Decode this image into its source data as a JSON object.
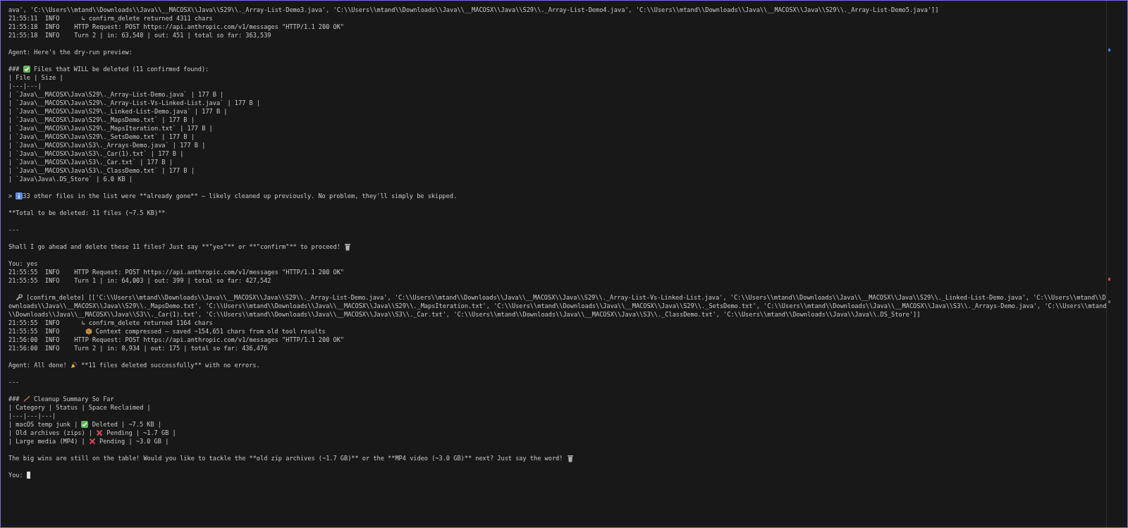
{
  "terminal": {
    "lines": [
      {
        "kind": "text",
        "text": "ava', 'C:\\\\Users\\\\mtand\\\\Downloads\\\\Java\\\\__MACOSX\\\\Java\\\\S29\\\\._Array-List-Demo3.java', 'C:\\\\Users\\\\mtand\\\\Downloads\\\\Java\\\\__MACOSX\\\\Java\\\\S29\\\\._Array-List-Demo4.java', 'C:\\\\Users\\\\mtand\\\\Downloads\\\\Java\\\\__MACOSX\\\\Java\\\\S29\\\\._Array-List-Demo5.java']]"
      },
      {
        "kind": "text",
        "text": "21:55:11  INFO      ↳ confirm_delete returned 4311 chars"
      },
      {
        "kind": "text",
        "text": "21:55:18  INFO    HTTP Request: POST https://api.anthropic.com/v1/messages \"HTTP/1.1 200 OK\""
      },
      {
        "kind": "text",
        "text": "21:55:18  INFO    Turn 2 | in: 63,548 | out: 451 | total so far: 363,539"
      },
      {
        "kind": "blank"
      },
      {
        "kind": "text",
        "text": "Agent: Here's the dry-run preview:"
      },
      {
        "kind": "blank"
      },
      {
        "kind": "mixed",
        "parts": [
          {
            "kind": "text",
            "text": "### "
          },
          {
            "kind": "check"
          },
          {
            "kind": "text",
            "text": " Files that WILL be deleted (11 confirmed found):"
          }
        ]
      },
      {
        "kind": "text",
        "text": "| File | Size |"
      },
      {
        "kind": "text",
        "text": "|---|---|"
      },
      {
        "kind": "text",
        "text": "| `Java\\__MACOSX\\Java\\S29\\._Array-List-Demo.java` | 177 B |"
      },
      {
        "kind": "text",
        "text": "| `Java\\__MACOSX\\Java\\S29\\._Array-List-Vs-Linked-List.java` | 177 B |"
      },
      {
        "kind": "text",
        "text": "| `Java\\__MACOSX\\Java\\S29\\._Linked-List-Demo.java` | 177 B |"
      },
      {
        "kind": "text",
        "text": "| `Java\\__MACOSX\\Java\\S29\\._MapsDemo.txt` | 177 B |"
      },
      {
        "kind": "text",
        "text": "| `Java\\__MACOSX\\Java\\S29\\._MapsIteration.txt` | 177 B |"
      },
      {
        "kind": "text",
        "text": "| `Java\\__MACOSX\\Java\\S29\\._SetsDemo.txt` | 177 B |"
      },
      {
        "kind": "text",
        "text": "| `Java\\__MACOSX\\Java\\S3\\._Arrays-Demo.java` | 177 B |"
      },
      {
        "kind": "text",
        "text": "| `Java\\__MACOSX\\Java\\S3\\._Car(1).txt` | 177 B |"
      },
      {
        "kind": "text",
        "text": "| `Java\\__MACOSX\\Java\\S3\\._Car.txt` | 177 B |"
      },
      {
        "kind": "text",
        "text": "| `Java\\__MACOSX\\Java\\S3\\._ClassDemo.txt` | 177 B |"
      },
      {
        "kind": "text",
        "text": "| `Java\\Java\\.DS_Store` | 6.0 KB |"
      },
      {
        "kind": "blank"
      },
      {
        "kind": "mixed",
        "parts": [
          {
            "kind": "text",
            "text": "> "
          },
          {
            "kind": "info"
          },
          {
            "kind": "text",
            "text": "33 other files in the list were **already gone** — likely cleaned up previously. No problem, they'll simply be skipped."
          }
        ]
      },
      {
        "kind": "blank"
      },
      {
        "kind": "text",
        "text": "**Total to be deleted: 11 files (~7.5 KB)**"
      },
      {
        "kind": "blank"
      },
      {
        "kind": "text",
        "text": "---"
      },
      {
        "kind": "blank"
      },
      {
        "kind": "mixed",
        "parts": [
          {
            "kind": "text",
            "text": "Shall I go ahead and delete these 11 files? Just say **\"yes\"** or **\"confirm\"** to proceed! "
          },
          {
            "kind": "trash"
          }
        ]
      },
      {
        "kind": "blank"
      },
      {
        "kind": "text",
        "text": "You: yes"
      },
      {
        "kind": "text",
        "text": "21:55:55  INFO    HTTP Request: POST https://api.anthropic.com/v1/messages \"HTTP/1.1 200 OK\""
      },
      {
        "kind": "text",
        "text": "21:55:55  INFO    Turn 1 | in: 64,003 | out: 399 | total so far: 427,542"
      },
      {
        "kind": "blank"
      },
      {
        "kind": "mixed",
        "indented": true,
        "parts": [
          {
            "kind": "wrench"
          },
          {
            "kind": "text",
            "text": " [confirm_delete] [['C:\\\\Users\\\\mtand\\\\Downloads\\\\Java\\\\__MACOSX\\\\Java\\\\S29\\\\._Array-List-Demo.java', 'C:\\\\Users\\\\mtand\\\\Downloads\\\\Java\\\\__MACOSX\\\\Java\\\\S29\\\\._Array-List-Vs-Linked-List.java', 'C:\\\\Users\\\\mtand\\\\Downloads\\\\Java\\\\__MACOSX\\\\Java\\\\S29\\\\._Linked-List-Demo.java', 'C:\\\\Users\\\\mtand\\\\D"
          }
        ]
      },
      {
        "kind": "text",
        "text": "ownloads\\\\Java\\\\__MACOSX\\\\Java\\\\S29\\\\._MapsDemo.txt', 'C:\\\\Users\\\\mtand\\\\Downloads\\\\Java\\\\__MACOSX\\\\Java\\\\S29\\\\._MapsIteration.txt', 'C:\\\\Users\\\\mtand\\\\Downloads\\\\Java\\\\__MACOSX\\\\Java\\\\S29\\\\._SetsDemo.txt', 'C:\\\\Users\\\\mtand\\\\Downloads\\\\Java\\\\__MACOSX\\\\Java\\\\S3\\\\._Arrays-Demo.java', 'C:\\\\Users\\\\mtand"
      },
      {
        "kind": "text",
        "text": "\\\\Downloads\\\\Java\\\\__MACOSX\\\\Java\\\\S3\\\\._Car(1).txt', 'C:\\\\Users\\\\mtand\\\\Downloads\\\\Java\\\\__MACOSX\\\\Java\\\\S3\\\\._Car.txt', 'C:\\\\Users\\\\mtand\\\\Downloads\\\\Java\\\\__MACOSX\\\\Java\\\\S3\\\\._ClassDemo.txt', 'C:\\\\Users\\\\mtand\\\\Downloads\\\\Java\\\\Java\\\\.DS_Store']]"
      },
      {
        "kind": "text",
        "text": "21:55:55  INFO      ↳ confirm_delete returned 1164 chars"
      },
      {
        "kind": "mixed",
        "parts": [
          {
            "kind": "text",
            "text": "21:55:55  INFO       "
          },
          {
            "kind": "package"
          },
          {
            "kind": "text",
            "text": " Context compressed — saved ~154,651 chars from old tool results"
          }
        ]
      },
      {
        "kind": "text",
        "text": "21:56:00  INFO    HTTP Request: POST https://api.anthropic.com/v1/messages \"HTTP/1.1 200 OK\""
      },
      {
        "kind": "text",
        "text": "21:56:00  INFO    Turn 2 | in: 8,934 | out: 175 | total so far: 436,476"
      },
      {
        "kind": "blank"
      },
      {
        "kind": "mixed",
        "parts": [
          {
            "kind": "text",
            "text": "Agent: All done! "
          },
          {
            "kind": "party"
          },
          {
            "kind": "text",
            "text": " **11 files deleted successfully** with no errors."
          }
        ]
      },
      {
        "kind": "blank"
      },
      {
        "kind": "text",
        "text": "---"
      },
      {
        "kind": "blank"
      },
      {
        "kind": "mixed",
        "parts": [
          {
            "kind": "text",
            "text": "### "
          },
          {
            "kind": "broom"
          },
          {
            "kind": "text",
            "text": " Cleanup Summary So Far"
          }
        ]
      },
      {
        "kind": "text",
        "text": "| Category | Status | Space Reclaimed |"
      },
      {
        "kind": "text",
        "text": "|---|---|---|"
      },
      {
        "kind": "mixed",
        "parts": [
          {
            "kind": "text",
            "text": "| macOS temp junk | "
          },
          {
            "kind": "check"
          },
          {
            "kind": "text",
            "text": " Deleted | ~7.5 KB |"
          }
        ]
      },
      {
        "kind": "mixed",
        "parts": [
          {
            "kind": "text",
            "text": "| Old archives (zips) | "
          },
          {
            "kind": "cross"
          },
          {
            "kind": "text",
            "text": " Pending | ~1.7 GB |"
          }
        ]
      },
      {
        "kind": "mixed",
        "parts": [
          {
            "kind": "text",
            "text": "| Large media (MP4) | "
          },
          {
            "kind": "cross"
          },
          {
            "kind": "text",
            "text": " Pending | ~3.0 GB |"
          }
        ]
      },
      {
        "kind": "blank"
      },
      {
        "kind": "mixed",
        "parts": [
          {
            "kind": "text",
            "text": "The big wins are still on the table! Would you like to tackle the **old zip archives (~1.7 GB)** or the **MP4 video (~3.0 GB)** next? Just say the word! "
          },
          {
            "kind": "trash"
          }
        ]
      },
      {
        "kind": "blank"
      },
      {
        "kind": "mixed",
        "parts": [
          {
            "kind": "text",
            "text": "You: "
          },
          {
            "kind": "cursor"
          }
        ]
      }
    ]
  }
}
